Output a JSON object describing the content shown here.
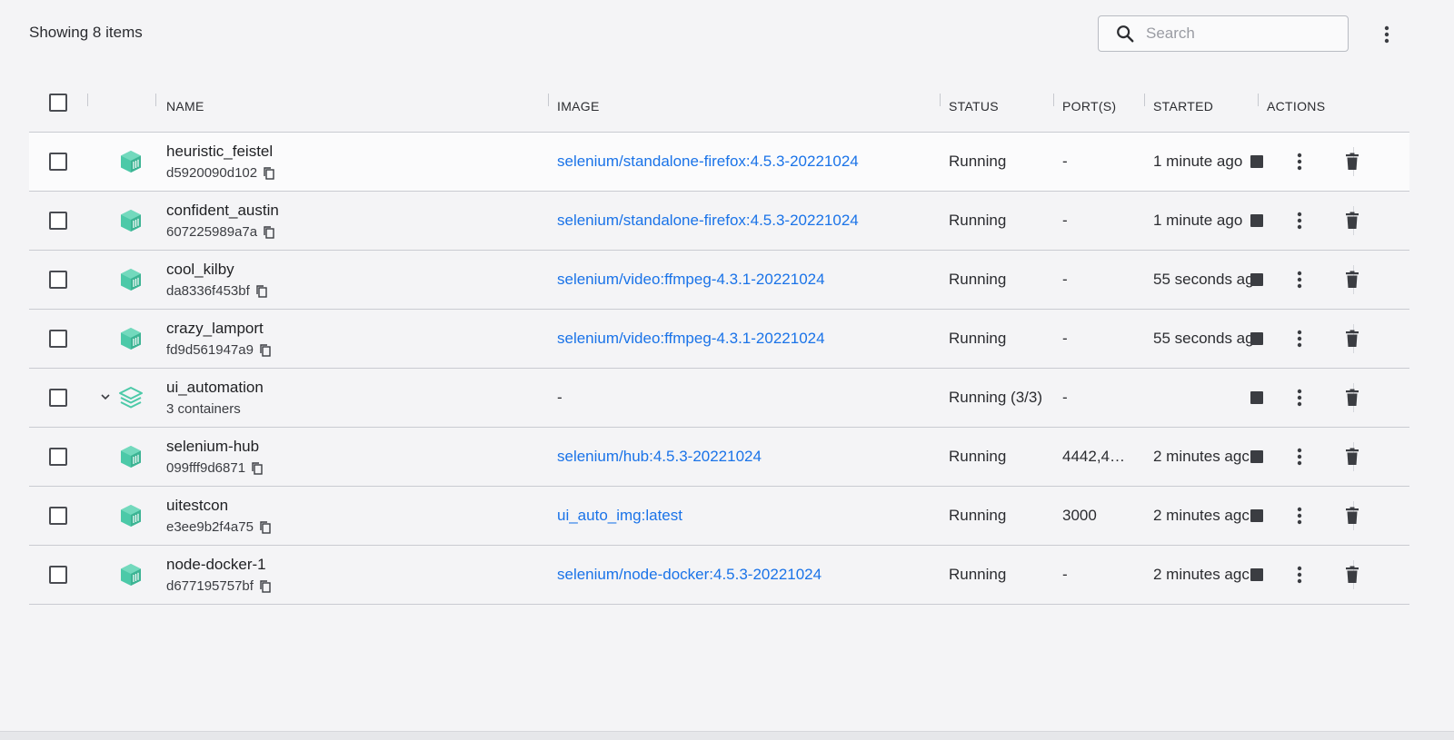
{
  "header": {
    "count_label": "Showing 8 items",
    "search_placeholder": "Search"
  },
  "columns": {
    "name": "NAME",
    "image": "IMAGE",
    "status": "STATUS",
    "ports": "PORT(S)",
    "started": "STARTED",
    "actions": "ACTIONS"
  },
  "rows": [
    {
      "name": "heuristic_feistel",
      "sub": "d5920090d102",
      "image": "selenium/standalone-firefox:4.5.3-20221024",
      "status": "Running",
      "ports": "-",
      "started": "1 minute ago",
      "kind": "container"
    },
    {
      "name": "confident_austin",
      "sub": "607225989a7a",
      "image": "selenium/standalone-firefox:4.5.3-20221024",
      "status": "Running",
      "ports": "-",
      "started": "1 minute ago",
      "kind": "container"
    },
    {
      "name": "cool_kilby",
      "sub": "da8336f453bf",
      "image": "selenium/video:ffmpeg-4.3.1-20221024",
      "status": "Running",
      "ports": "-",
      "started": "55 seconds ag",
      "kind": "container"
    },
    {
      "name": "crazy_lamport",
      "sub": "fd9d561947a9",
      "image": "selenium/video:ffmpeg-4.3.1-20221024",
      "status": "Running",
      "ports": "-",
      "started": "55 seconds ag",
      "kind": "container"
    },
    {
      "name": "ui_automation",
      "sub": "3 containers",
      "image": "-",
      "status": "Running (3/3)",
      "ports": "-",
      "started": "",
      "kind": "group"
    },
    {
      "name": "selenium-hub",
      "sub": "099fff9d6871",
      "image": "selenium/hub:4.5.3-20221024",
      "status": "Running",
      "ports": "4442,4…",
      "started": "2 minutes agc",
      "kind": "container"
    },
    {
      "name": "uitestcon",
      "sub": "e3ee9b2f4a75",
      "image": "ui_auto_img:latest",
      "status": "Running",
      "ports": "3000",
      "started": "2 minutes agc",
      "kind": "container"
    },
    {
      "name": "node-docker-1",
      "sub": "d677195757bf",
      "image": "selenium/node-docker:4.5.3-20221024",
      "status": "Running",
      "ports": "-",
      "started": "2 minutes agc",
      "kind": "container"
    }
  ],
  "icons": {
    "container": "container-cube-icon",
    "group": "stack-layers-icon",
    "stop": "stop-icon",
    "more": "kebab-menu-icon",
    "delete": "trash-icon",
    "copy": "copy-icon",
    "search": "search-icon"
  },
  "colors": {
    "accent_link": "#1a73e8",
    "icon_teal": "#4cc9a8"
  }
}
